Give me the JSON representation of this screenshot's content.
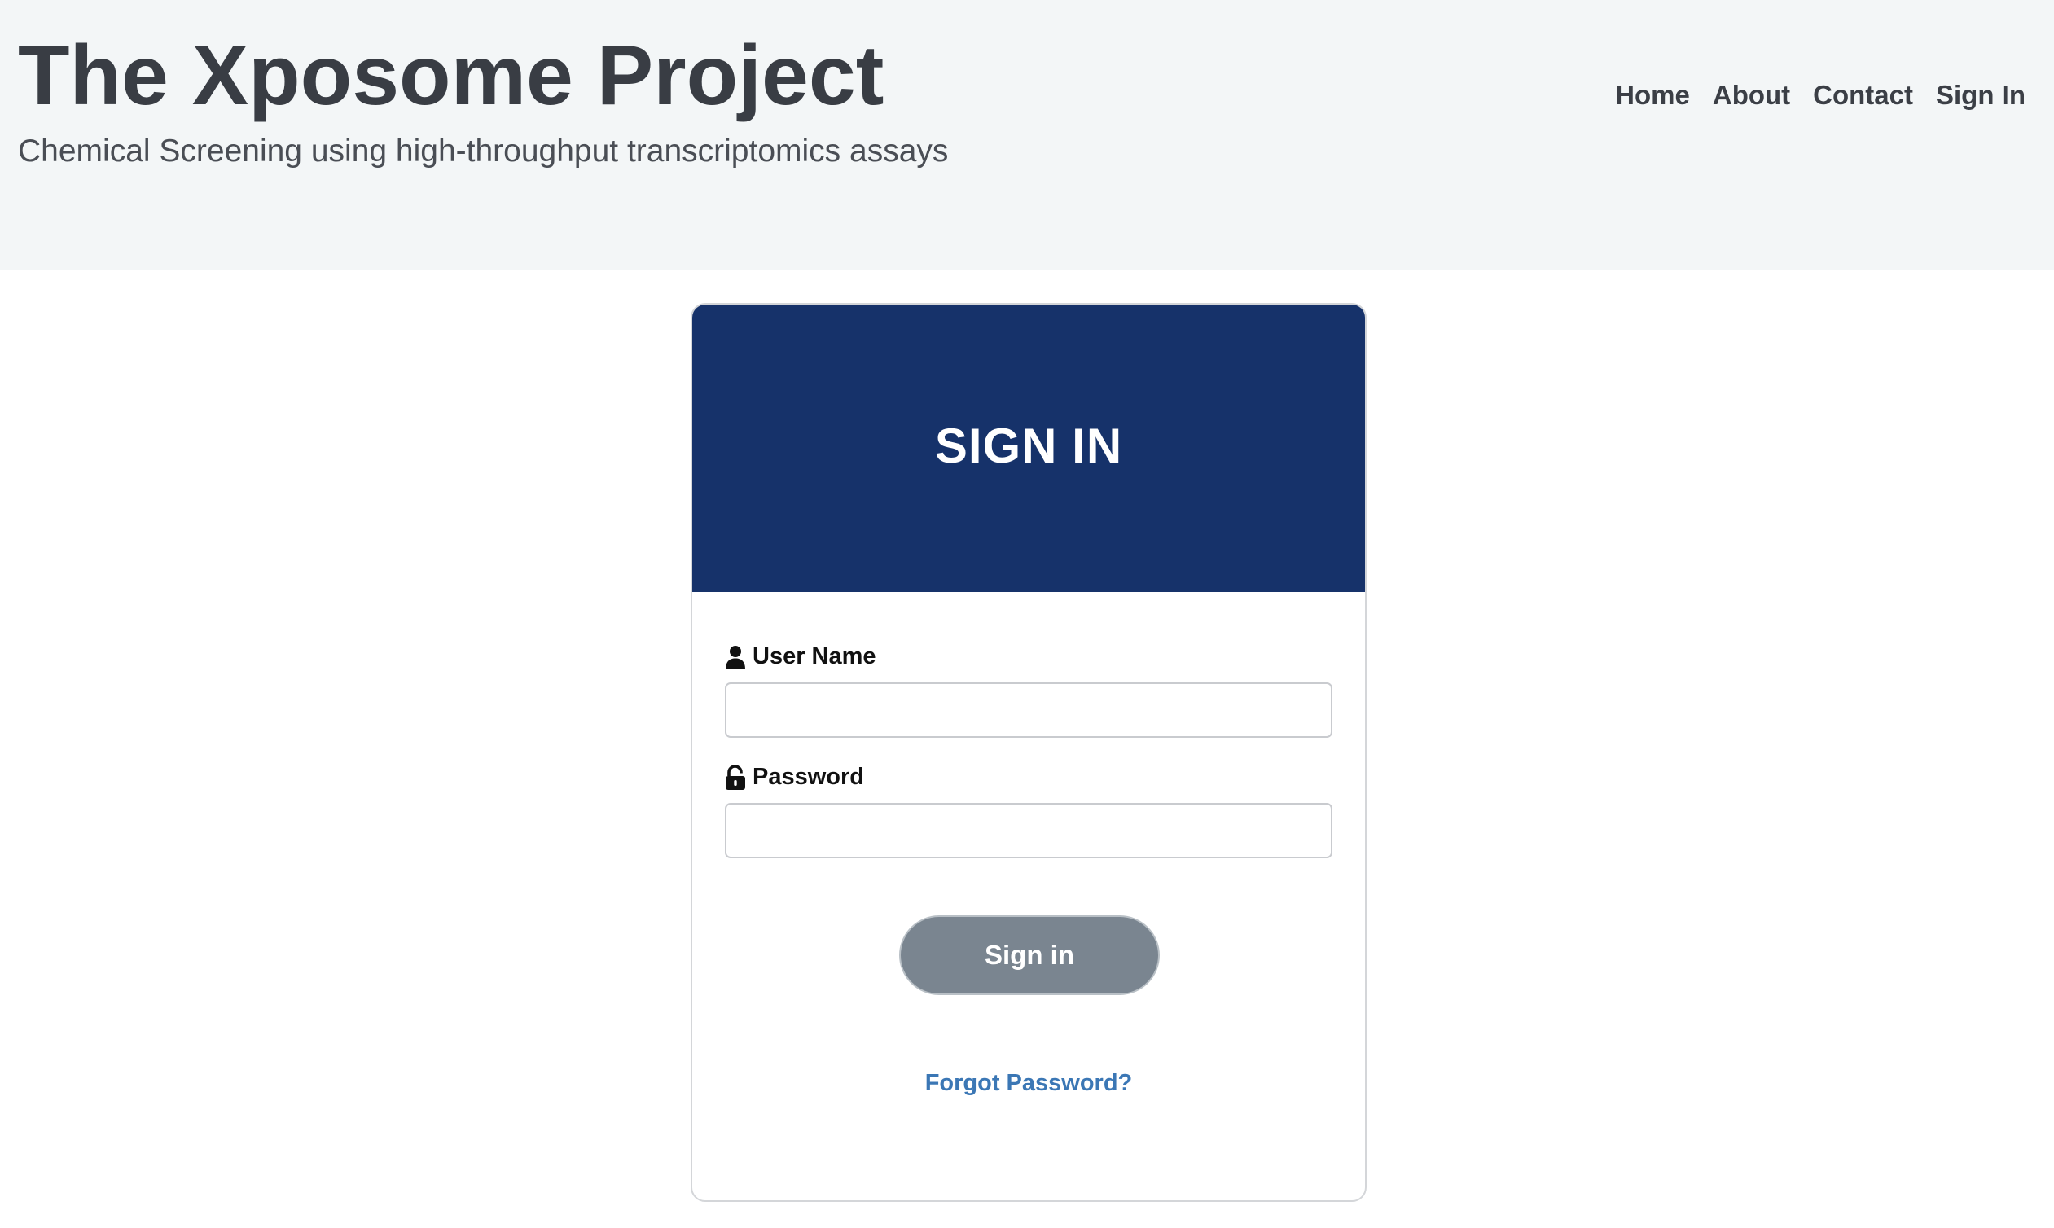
{
  "header": {
    "title": "The Xposome Project",
    "tagline": "Chemical Screening using high-throughput transcriptomics assays",
    "nav": [
      {
        "label": "Home"
      },
      {
        "label": "About"
      },
      {
        "label": "Contact"
      },
      {
        "label": "Sign In"
      }
    ]
  },
  "signin": {
    "title": "SIGN IN",
    "username": {
      "label": "User Name",
      "value": "",
      "icon": "user-icon"
    },
    "password": {
      "label": "Password",
      "value": "",
      "icon": "lock-open-icon"
    },
    "submit_label": "Sign in",
    "forgot_label": "Forgot Password?"
  },
  "colors": {
    "header_bg": "#f3f6f7",
    "card_header_bg": "#16326a",
    "button_bg": "#7a8590",
    "link": "#3b77b5",
    "title_text": "#393d44"
  }
}
